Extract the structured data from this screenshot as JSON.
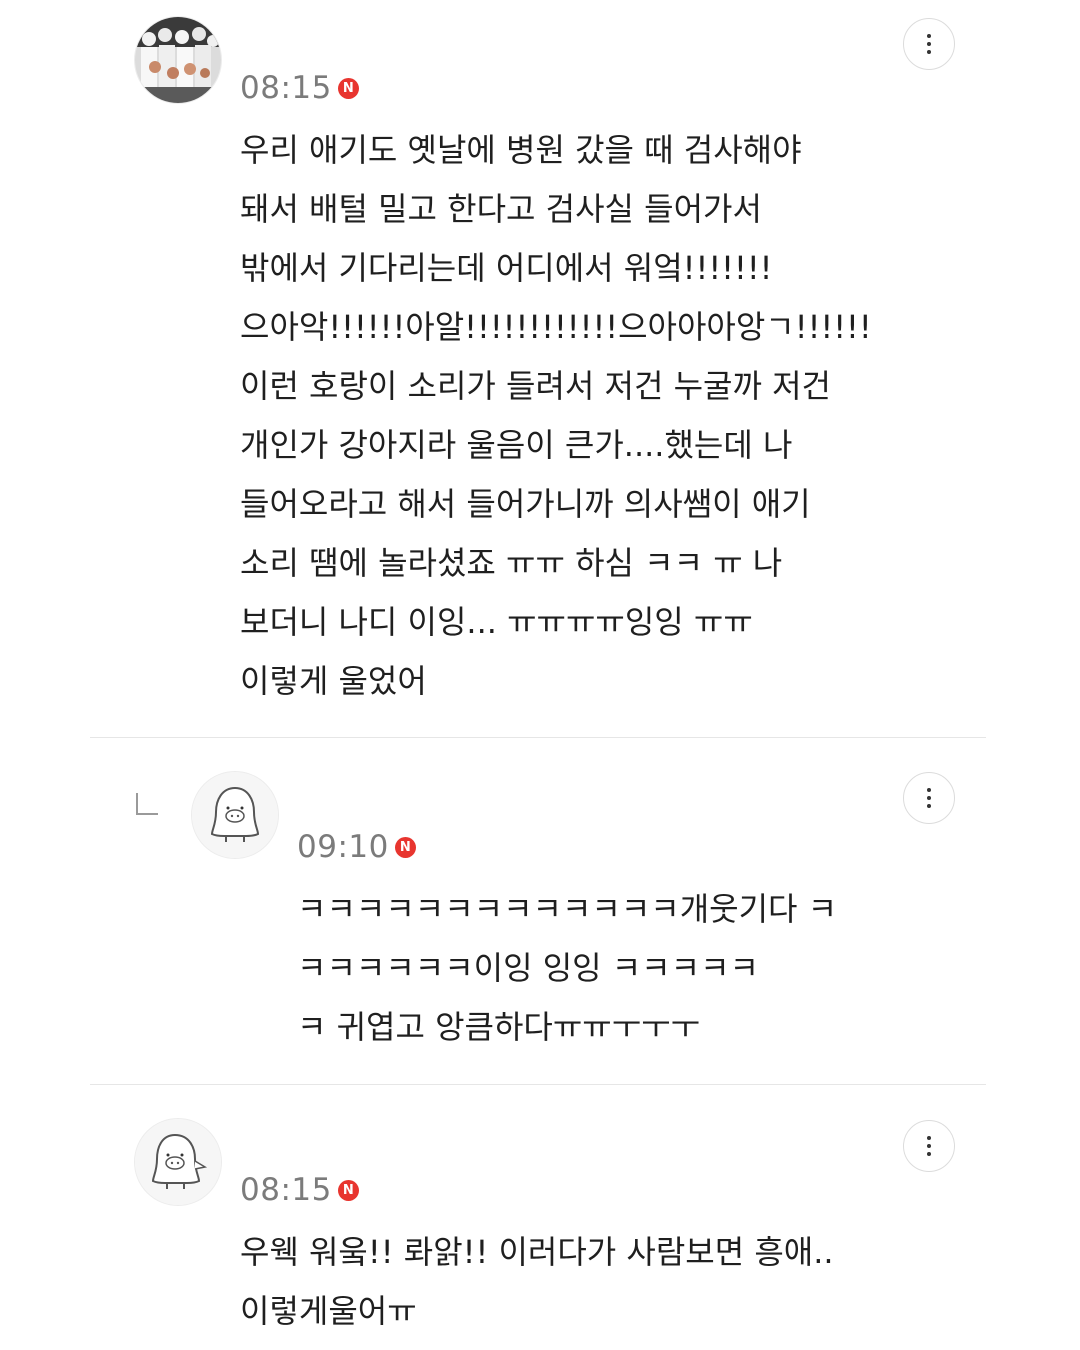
{
  "comments": [
    {
      "time": "08:15",
      "badge": "N",
      "avatar_icon": "group-photo-avatar-icon",
      "text": "우리 애기도 옛날에 병원 갔을 때 검사해야\n돼서 배털 밀고 한다고 검사실 들어가서\n밖에서 기다리는데 어디에서 워엌!!!!!!!\n으아악!!!!!!아알!!!!!!!!!!!!으아아아앙ㄱ!!!!!!\n이런 호랑이 소리가 들려서 저건 누굴까 저건\n개인가 강아지라 울음이 큰가....했는데 나\n들어오라고 해서 들어가니까 의사쌤이 애기\n소리 땜에 놀라셨죠 ㅠㅠ 하심 ㅋㅋ ㅠ 나\n보더니 나디 이잉... ㅠㅠㅠㅠ잉잉 ㅠㅠ\n이렇게 울었어"
    },
    {
      "time": "09:10",
      "badge": "N",
      "avatar_icon": "penguin-avatar-icon",
      "text": "ㅋㅋㅋㅋㅋㅋㅋㅋㅋㅋㅋㅋㅋ개웃기다 ㅋ\nㅋㅋㅋㅋㅋㅋ이잉 잉잉 ㅋㅋㅋㅋㅋ\nㅋ 귀엽고 앙큼하다ㅠㅠㅜㅜㅜ"
    },
    {
      "time": "08:15",
      "badge": "N",
      "avatar_icon": "penguin-avatar-icon",
      "text": "우웩 워웈!! 롸앍!! 이러다가 사람보면 흥애..\n이렇게울어ㅠ"
    }
  ],
  "colors": {
    "badge": "#e8352f",
    "time": "#7b7b7b",
    "text": "#1f1f1f",
    "divider": "#e6e6e6"
  },
  "icons": {
    "more": "more-vertical-icon",
    "reply": "reply-arrow-icon",
    "new": "new-badge-icon"
  }
}
